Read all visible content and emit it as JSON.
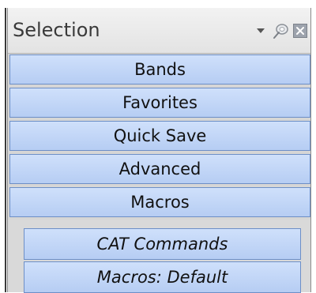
{
  "panel": {
    "title": "Selection",
    "controls": {
      "dropdown_icon": "chevron-down-icon",
      "pin_icon": "pin-icon",
      "close_icon": "close-icon"
    }
  },
  "buttons": [
    {
      "label": "Bands"
    },
    {
      "label": "Favorites"
    },
    {
      "label": "Quick Save"
    },
    {
      "label": "Advanced"
    },
    {
      "label": "Macros"
    }
  ],
  "sub_buttons": [
    {
      "label": "CAT Commands"
    },
    {
      "label": "Macros: Default"
    }
  ],
  "colors": {
    "button_fill_top": "#cfe0fb",
    "button_fill_bottom": "#b6cdf3",
    "button_border": "#6d8fc7",
    "title_text": "#3a3a3a"
  }
}
